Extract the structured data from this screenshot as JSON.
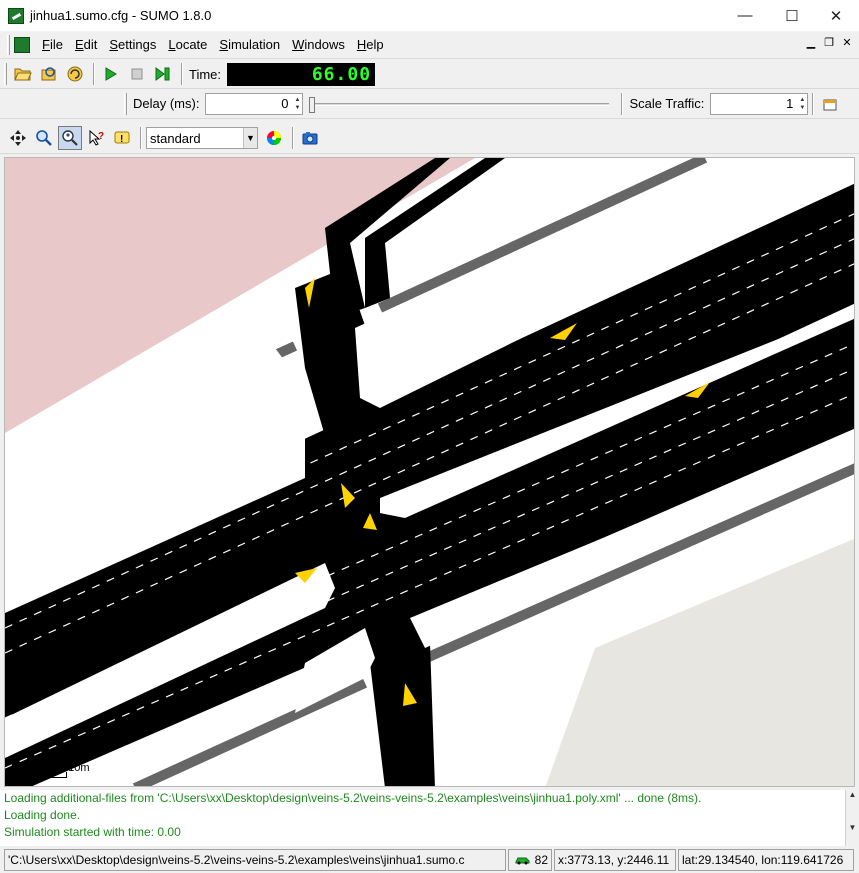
{
  "window": {
    "title": "jinhua1.sumo.cfg - SUMO 1.8.0",
    "minimize_glyph": "—",
    "maximize_glyph": "☐",
    "close_glyph": "✕"
  },
  "menu": {
    "items": [
      {
        "label": "File",
        "mnemonic": "F",
        "rest": "ile"
      },
      {
        "label": "Edit",
        "mnemonic": "E",
        "rest": "dit"
      },
      {
        "label": "Settings",
        "mnemonic": "S",
        "rest": "ettings"
      },
      {
        "label": "Locate",
        "mnemonic": "L",
        "rest": "ocate"
      },
      {
        "label": "Simulation",
        "mnemonic": "S",
        "rest": "imulation"
      },
      {
        "label": "Windows",
        "mnemonic": "W",
        "rest": "indows"
      },
      {
        "label": "Help",
        "mnemonic": "H",
        "rest": "elp"
      }
    ]
  },
  "toolbar": {
    "time_label": "Time:",
    "time_value": "66.00",
    "delay_label": "Delay (ms):",
    "delay_value": "0",
    "delay_slider_fraction": 0.0,
    "scale_label": "Scale Traffic:",
    "scale_value": "1"
  },
  "view": {
    "scheme_selected": "standard"
  },
  "map": {
    "scale_zero": "0",
    "scale_length": "10m",
    "colors": {
      "road": "#000000",
      "sidewalk": "#666666",
      "building": "#e8c8c8",
      "land": "#e8e6e0",
      "vehicle": "#ffd200"
    }
  },
  "log": {
    "lines": [
      "Loading additional-files from 'C:\\Users\\xx\\Desktop\\design\\veins-5.2\\veins-veins-5.2\\examples\\veins\\jinhua1.poly.xml' ... done (8ms).",
      "Loading done.",
      "Simulation started with time: 0.00"
    ]
  },
  "status": {
    "path": "'C:\\Users\\xx\\Desktop\\design\\veins-5.2\\veins-veins-5.2\\examples\\veins\\jinhua1.sumo.c",
    "vehicle_count": "82",
    "coords": "x:3773.13, y:2446.11",
    "geo": "lat:29.134540, lon:119.641726"
  }
}
